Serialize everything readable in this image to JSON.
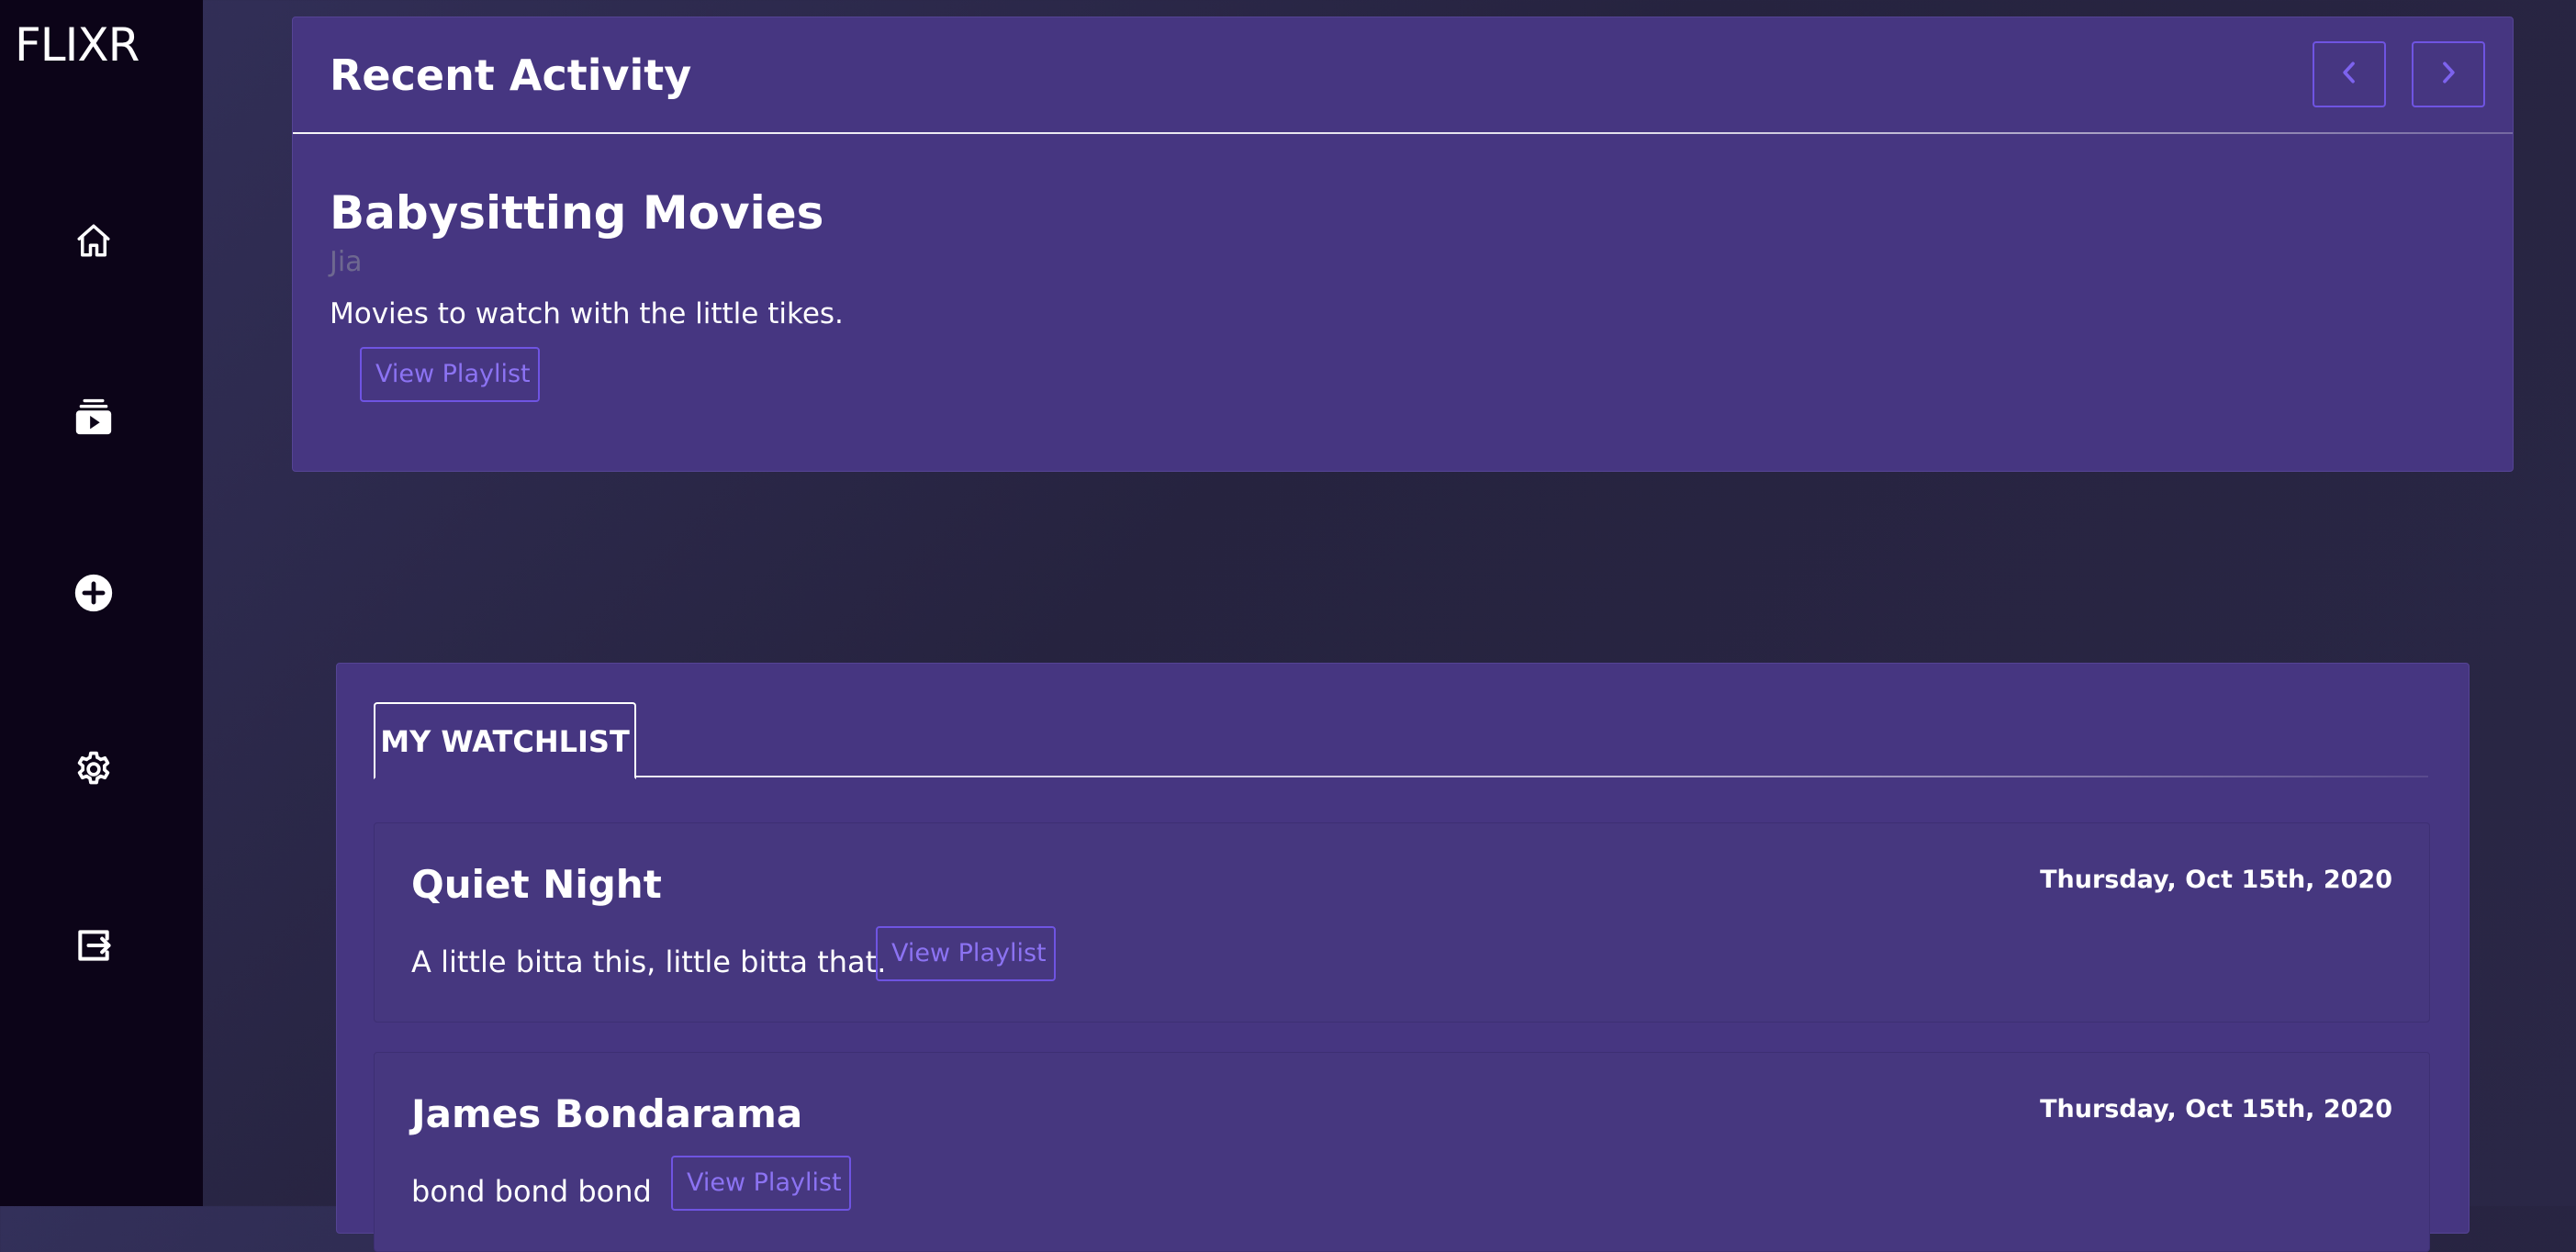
{
  "brand": {
    "logo_text": "FLIXR"
  },
  "sidebar": {
    "items": [
      {
        "icon": "home-icon",
        "label": "Home"
      },
      {
        "icon": "playlists-icon",
        "label": "Playlists"
      },
      {
        "icon": "add-circle-icon",
        "label": "Add"
      },
      {
        "icon": "gear-icon",
        "label": "Settings"
      },
      {
        "icon": "logout-icon",
        "label": "Logout"
      }
    ]
  },
  "recent_activity": {
    "title": "Recent Activity",
    "prev_icon": "chevron-left-icon",
    "next_icon": "chevron-right-icon",
    "playlist": {
      "name": "Babysitting Movies",
      "owner": "Jia",
      "description": "Movies to watch with the little tikes.",
      "button_label": "View Playlist"
    }
  },
  "watchlist": {
    "tab_label": "MY WATCHLIST",
    "items": [
      {
        "name": "Quiet Night",
        "date": "Thursday, Oct 15th, 2020",
        "description": "A little bitta this, little bitta that.",
        "button_label": "View Playlist"
      },
      {
        "name": "James Bondarama",
        "date": "Thursday, Oct 15th, 2020",
        "description": "bond bond bond",
        "button_label": "View Playlist"
      }
    ]
  },
  "colors": {
    "sidebar_bg": "#0c0418",
    "panel_bg": "#463681",
    "accent": "#6f54e2",
    "page_bg": "#2a2746",
    "muted_text": "#6e6890"
  }
}
